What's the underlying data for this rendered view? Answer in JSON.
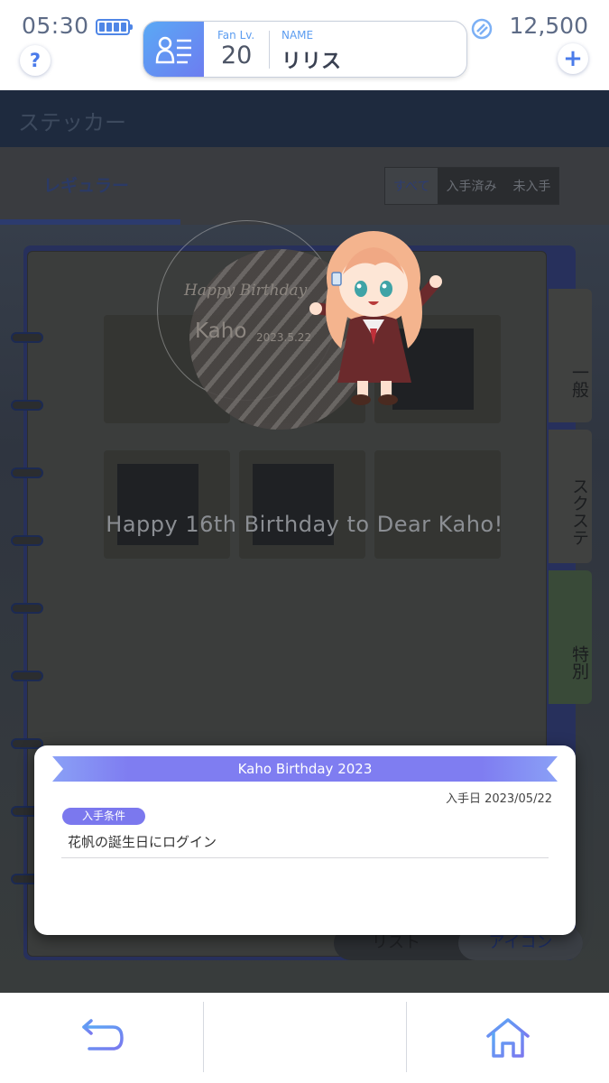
{
  "status": {
    "time": "05:30"
  },
  "header": {
    "help_label": "?",
    "add_label": "+",
    "fan_label": "Fan Lv.",
    "fan_level": "20",
    "name_label": "NAME",
    "player_name": "リリス",
    "currency": "12,500"
  },
  "scene": {
    "title": "ステッカー",
    "tab": "レギュラー",
    "filters": [
      "すべて",
      "入手済み",
      "未入手"
    ],
    "side_tabs": [
      "一般",
      "スクステ",
      "特別"
    ],
    "view_toggle": [
      "リスト",
      "アイコン"
    ]
  },
  "sticker": {
    "script_text": "Happy Birthday",
    "name": "Kaho",
    "date": "2023.5.22"
  },
  "caption": "Happy 16th Birthday to Dear Kaho!",
  "modal": {
    "title": "Kaho Birthday 2023",
    "acquired_date": "入手日 2023/05/22",
    "condition_label": "入手条件",
    "condition_text": "花帆の誕生日にログイン"
  },
  "colors": {
    "accent": "#4f86e6",
    "banner": "#7f7df1",
    "badge": "#7b78ee"
  },
  "icons": [
    "battery-icon",
    "help-icon",
    "profile-card-icon",
    "currency-gem-icon",
    "add-icon",
    "back-icon",
    "menu-icon",
    "home-icon"
  ]
}
